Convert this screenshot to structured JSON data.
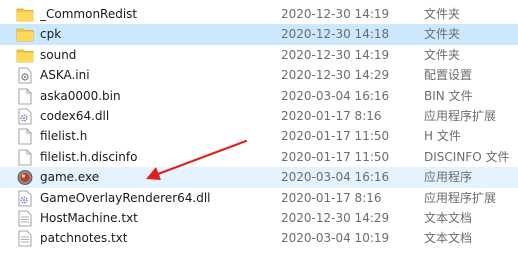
{
  "files": [
    {
      "name": "_CommonRedist",
      "date": "2020-12-30 14:19",
      "type": "文件夹",
      "icon": "folder-icon"
    },
    {
      "name": "cpk",
      "date": "2020-12-30 14:18",
      "type": "文件夹",
      "icon": "folder-icon"
    },
    {
      "name": "sound",
      "date": "2020-12-30 14:19",
      "type": "文件夹",
      "icon": "folder-icon"
    },
    {
      "name": "ASKA.ini",
      "date": "2020-12-30 14:29",
      "type": "配置设置",
      "icon": "ini-settings-icon"
    },
    {
      "name": "aska0000.bin",
      "date": "2020-03-04 16:16",
      "type": "BIN 文件",
      "icon": "file-icon"
    },
    {
      "name": "codex64.dll",
      "date": "2020-01-17 8:16",
      "type": "应用程序扩展",
      "icon": "dll-gear-icon"
    },
    {
      "name": "filelist.h",
      "date": "2020-01-17 11:50",
      "type": "H 文件",
      "icon": "file-icon"
    },
    {
      "name": "filelist.h.discinfo",
      "date": "2020-01-17 11:50",
      "type": "DISCINFO 文件",
      "icon": "file-icon"
    },
    {
      "name": "game.exe",
      "date": "2020-03-04 16:16",
      "type": "应用程序",
      "icon": "game-exe-icon"
    },
    {
      "name": "GameOverlayRenderer64.dll",
      "date": "2020-01-17 8:16",
      "type": "应用程序扩展",
      "icon": "dll-gear-icon"
    },
    {
      "name": "HostMachine.txt",
      "date": "2020-12-30 14:29",
      "type": "文本文档",
      "icon": "text-file-icon"
    },
    {
      "name": "patchnotes.txt",
      "date": "2020-03-04 10:19",
      "type": "文本文档",
      "icon": "text-file-icon"
    }
  ],
  "colors": {
    "selected_row": "#cce8ff",
    "hover_row": "#e5f3ff",
    "arrow": "#e02020",
    "folder": "#f5c842"
  },
  "annotation": {
    "icon": "red-arrow-icon",
    "points_to": "game.exe"
  }
}
